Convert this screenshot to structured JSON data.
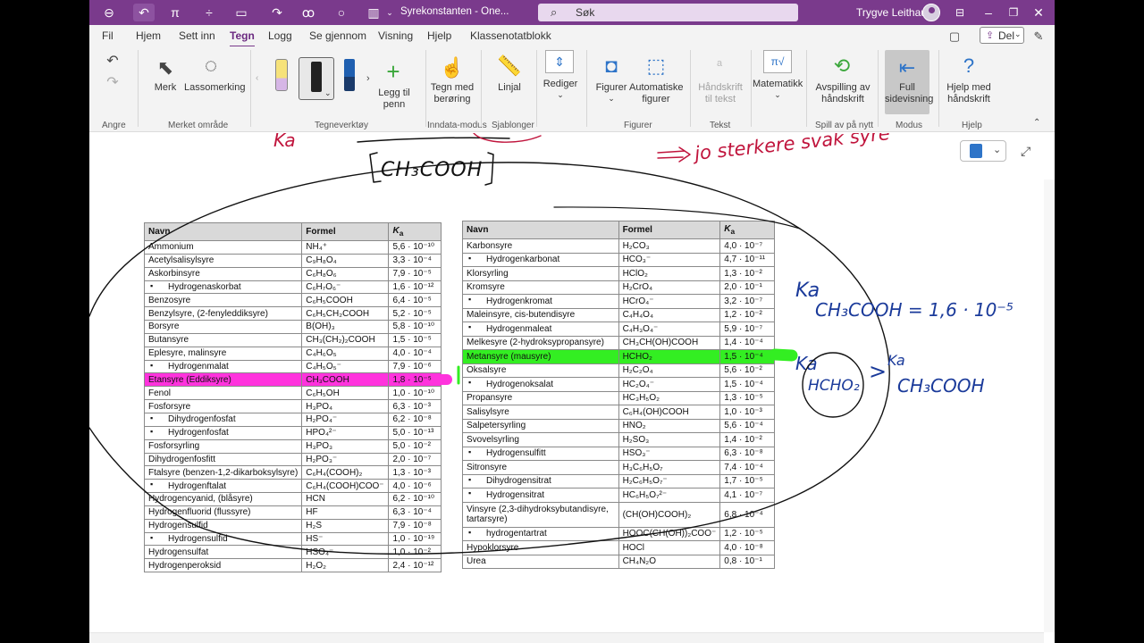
{
  "titlebar": {
    "doc_title": "Syrekonstanten - One...",
    "search_label": "Søk",
    "user_name": "Trygve Leithaug"
  },
  "tabs": [
    "Fil",
    "Hjem",
    "Sett inn",
    "Tegn",
    "Logg",
    "Se gjennom",
    "Visning",
    "Hjelp",
    "Klassenotatblokk"
  ],
  "active_tab": "Tegn",
  "share_label": "Del",
  "ribbon": {
    "merk": "Merk",
    "lassomerking": "Lassomerking",
    "legg_til_penn": "Legg til penn",
    "tegn_med_beroring": "Tegn med berøring",
    "linjal": "Linjal",
    "rediger": "Rediger",
    "figurer": "Figurer",
    "automatiske_figurer": "Automatiske figurer",
    "handskrift_til_tekst": "Håndskrift til tekst",
    "matematikk": "Matematikk",
    "avspilling": "Avspilling av håndskrift",
    "full_sidevisning": "Full sidevisning",
    "hjelp_med_handskrift": "Hjelp med håndskrift"
  },
  "groups": {
    "angre": "Angre",
    "merket_omrade": "Merket område",
    "tegneverktoy": "Tegneverktøy",
    "inndata_modus": "Inndata-modus",
    "sjablonger": "Sjablonger",
    "figurer": "Figurer",
    "tekst": "Tekst",
    "spill_av": "Spill av på nytt",
    "modus": "Modus",
    "hjelp": "Hjelp"
  },
  "tableA": {
    "headers": [
      "Navn",
      "Formel",
      "Ka"
    ],
    "rows": [
      {
        "name": "Ammonium",
        "formula": "NH₄⁺",
        "ka": "5,6 · 10⁻¹⁰"
      },
      {
        "name": "Acetylsalisylsyre",
        "formula": "C₉H₈O₄",
        "ka": "3,3 · 10⁻⁴"
      },
      {
        "name": "Askorbinsyre",
        "formula": "C₆H₈O₆",
        "ka": "7,9 · 10⁻⁵"
      },
      {
        "name": "Hydrogenaskorbat",
        "formula": "C₆H₇O₆⁻",
        "ka": "1,6 · 10⁻¹²",
        "indent": true
      },
      {
        "name": "Benzosyre",
        "formula": "C₆H₅COOH",
        "ka": "6,4 · 10⁻⁵"
      },
      {
        "name": "Benzylsyre, (2-fenyleddiksyre)",
        "formula": "C₆H₅CH₂COOH",
        "ka": "5,2 · 10⁻⁵"
      },
      {
        "name": "Borsyre",
        "formula": "B(OH)₃",
        "ka": "5,8 · 10⁻¹⁰"
      },
      {
        "name": "Butansyre",
        "formula": "CH₃(CH₂)₂COOH",
        "ka": "1,5 · 10⁻⁵"
      },
      {
        "name": "Eplesyre, malinsyre",
        "formula": "C₄H₆O₅",
        "ka": "4,0 · 10⁻⁴"
      },
      {
        "name": "Hydrogenmalat",
        "formula": "C₄H₅O₅⁻",
        "ka": "7,9 · 10⁻⁶",
        "indent": true
      },
      {
        "name": "Etansyre (Eddiksyre)",
        "formula": "CH₃COOH",
        "ka": "1,8 · 10⁻⁵",
        "highlight": "pink"
      },
      {
        "name": "Fenol",
        "formula": "C₆H₅OH",
        "ka": "1,0 · 10⁻¹⁰"
      },
      {
        "name": "Fosforsyre",
        "formula": "H₃PO₄",
        "ka": "6,3 · 10⁻³"
      },
      {
        "name": "Dihydrogenfosfat",
        "formula": "H₂PO₄⁻",
        "ka": "6,2 · 10⁻⁸",
        "indent": true
      },
      {
        "name": "Hydrogenfosfat",
        "formula": "HPO₄²⁻",
        "ka": "5,0 · 10⁻¹³",
        "indent": true
      },
      {
        "name": "Fosforsyrling",
        "formula": "H₃PO₃",
        "ka": "5,0 · 10⁻²"
      },
      {
        "name": "Dihydrogenfosfitt",
        "formula": "H₂PO₃⁻",
        "ka": "2,0 · 10⁻⁷"
      },
      {
        "name": "Ftalsyre (benzen-1,2-dikarboksylsyre)",
        "formula": "C₆H₄(COOH)₂",
        "ka": "1,3 · 10⁻³"
      },
      {
        "name": "Hydrogenftalat",
        "formula": "C₆H₄(COOH)COO⁻",
        "ka": "4,0 · 10⁻⁶",
        "indent": true
      },
      {
        "name": "Hydrogencyanid, (blåsyre)",
        "formula": "HCN",
        "ka": "6,2 · 10⁻¹⁰"
      },
      {
        "name": "Hydrogenfluorid (flussyre)",
        "formula": "HF",
        "ka": "6,3 · 10⁻⁴"
      },
      {
        "name": "Hydrogensulfid",
        "formula": "H₂S",
        "ka": "7,9 · 10⁻⁸"
      },
      {
        "name": "Hydrogensulfid",
        "formula": "HS⁻",
        "ka": "1,0 · 10⁻¹⁹",
        "indent": true
      },
      {
        "name": "Hydrogensulfat",
        "formula": "HSO₄⁻",
        "ka": "1,0 · 10⁻²"
      },
      {
        "name": "Hydrogenperoksid",
        "formula": "H₂O₂",
        "ka": "2,4 · 10⁻¹²"
      }
    ]
  },
  "tableB": {
    "headers": [
      "Navn",
      "Formel",
      "Ka"
    ],
    "rows": [
      {
        "name": "Karbonsyre",
        "formula": "H₂CO₃",
        "ka": "4,0 · 10⁻⁷"
      },
      {
        "name": "Hydrogenkarbonat",
        "formula": "HCO₃⁻",
        "ka": "4,7 · 10⁻¹¹",
        "indent": true
      },
      {
        "name": "Klorsyrling",
        "formula": "HClO₂",
        "ka": "1,3 · 10⁻²"
      },
      {
        "name": "Kromsyre",
        "formula": "H₂CrO₄",
        "ka": "2,0 · 10⁻¹"
      },
      {
        "name": "Hydrogenkromat",
        "formula": "HCrO₄⁻",
        "ka": "3,2 · 10⁻⁷",
        "indent": true
      },
      {
        "name": "Maleinsyre, cis-butendisyre",
        "formula": "C₄H₄O₄",
        "ka": "1,2 · 10⁻²"
      },
      {
        "name": "Hydrogenmaleat",
        "formula": "C₄H₃O₄⁻",
        "ka": "5,9 · 10⁻⁷",
        "indent": true
      },
      {
        "name": "Melkesyre (2-hydroksypropansyre)",
        "formula": "CH₃CH(OH)COOH",
        "ka": "1,4 · 10⁻⁴"
      },
      {
        "name": "Metansyre (mausyre)",
        "formula": "HCHO₂",
        "ka": "1,5 · 10⁻⁴",
        "highlight": "green"
      },
      {
        "name": "Oksalsyre",
        "formula": "H₂C₂O₄",
        "ka": "5,6 · 10⁻²"
      },
      {
        "name": "Hydrogenoksalat",
        "formula": "HC₂O₄⁻",
        "ka": "1,5 · 10⁻⁴",
        "indent": true
      },
      {
        "name": "Propansyre",
        "formula": "HC₃H₅O₂",
        "ka": "1,3 · 10⁻⁵"
      },
      {
        "name": "Salisylsyre",
        "formula": "C₆H₄(OH)COOH",
        "ka": "1,0 · 10⁻³"
      },
      {
        "name": "Salpetersyrling",
        "formula": "HNO₂",
        "ka": "5,6 · 10⁻⁴"
      },
      {
        "name": "Svovelsyrling",
        "formula": "H₂SO₃",
        "ka": "1,4 · 10⁻²"
      },
      {
        "name": "Hydrogensulfitt",
        "formula": "HSO₃⁻",
        "ka": "6,3 · 10⁻⁸",
        "indent": true
      },
      {
        "name": "Sitronsyre",
        "formula": "H₃C₆H₅O₇",
        "ka": "7,4 · 10⁻⁴"
      },
      {
        "name": "Dihydrogensitrat",
        "formula": "H₂C₆H₅O₇⁻",
        "ka": "1,7 · 10⁻⁵",
        "indent": true
      },
      {
        "name": "Hydrogensitrat",
        "formula": "HC₆H₅O₇²⁻",
        "ka": "4,1 · 10⁻⁷",
        "indent": true
      },
      {
        "name": "Vinsyre (2,3-dihydroksybutandisyre, tartarsyre)",
        "formula": "(CH(OH)COOH)₂",
        "ka": "6,8 · 10⁻⁴",
        "tall": true
      },
      {
        "name": "hydrogentartrat",
        "formula": "HOOC(CH(OH))₂COO⁻",
        "ka": "1,2 · 10⁻⁵",
        "indent": true
      },
      {
        "name": "Hypoklorsyre",
        "formula": "HOCl",
        "ka": "4,0 · 10⁻⁸"
      },
      {
        "name": "Urea",
        "formula": "CH₄N₂O",
        "ka": "0,8 · 10⁻¹"
      }
    ]
  },
  "colors": {
    "brand": "#7a3a8c",
    "highlight_pink": "#ff33dd",
    "highlight_green": "#33ee22",
    "ink_red": "#c0143c",
    "ink_blue": "#1a3a9a",
    "ink_black": "#111111"
  }
}
